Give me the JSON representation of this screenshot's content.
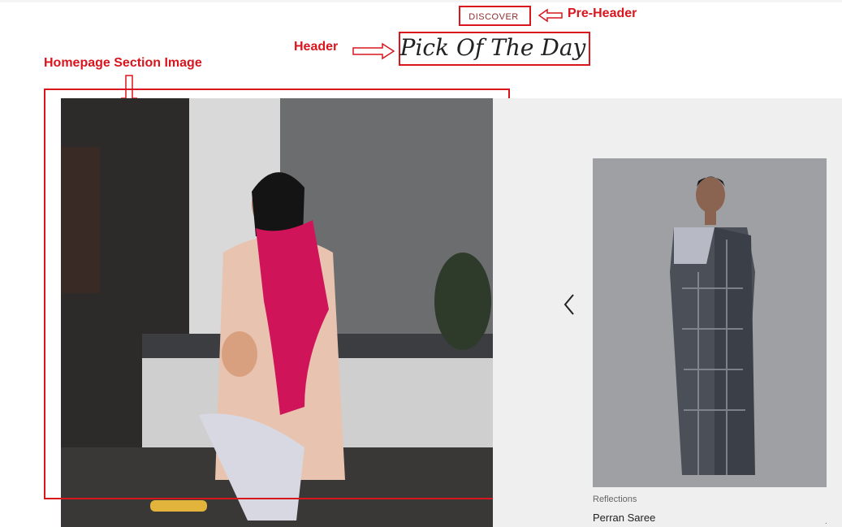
{
  "annotations": {
    "pre_header_label": "Pre-Header",
    "header_label": "Header",
    "section_image_label": "Homepage Section Image"
  },
  "section": {
    "pre_header": "DISCOVER",
    "title": "Pick Of The Day"
  },
  "product": {
    "collection": "Reflections",
    "name": "Perran Saree",
    "more": "."
  },
  "icons": {
    "prev": "chevron-left-icon"
  },
  "colors": {
    "annotation": "#d9151d",
    "panel_bg": "#efefef",
    "scarf": "#d0145a"
  }
}
